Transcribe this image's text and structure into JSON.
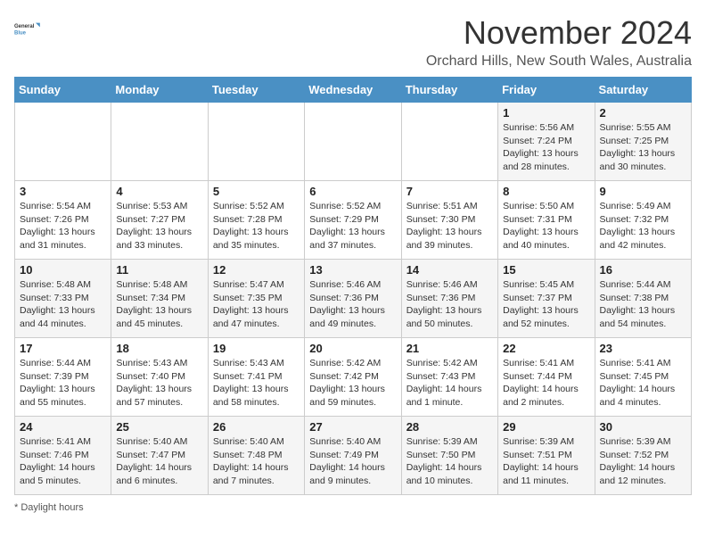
{
  "logo": {
    "line1": "General",
    "line2": "Blue"
  },
  "header": {
    "month": "November 2024",
    "location": "Orchard Hills, New South Wales, Australia"
  },
  "weekdays": [
    "Sunday",
    "Monday",
    "Tuesday",
    "Wednesday",
    "Thursday",
    "Friday",
    "Saturday"
  ],
  "weeks": [
    [
      {
        "day": "",
        "info": ""
      },
      {
        "day": "",
        "info": ""
      },
      {
        "day": "",
        "info": ""
      },
      {
        "day": "",
        "info": ""
      },
      {
        "day": "",
        "info": ""
      },
      {
        "day": "1",
        "info": "Sunrise: 5:56 AM\nSunset: 7:24 PM\nDaylight: 13 hours and 28 minutes."
      },
      {
        "day": "2",
        "info": "Sunrise: 5:55 AM\nSunset: 7:25 PM\nDaylight: 13 hours and 30 minutes."
      }
    ],
    [
      {
        "day": "3",
        "info": "Sunrise: 5:54 AM\nSunset: 7:26 PM\nDaylight: 13 hours and 31 minutes."
      },
      {
        "day": "4",
        "info": "Sunrise: 5:53 AM\nSunset: 7:27 PM\nDaylight: 13 hours and 33 minutes."
      },
      {
        "day": "5",
        "info": "Sunrise: 5:52 AM\nSunset: 7:28 PM\nDaylight: 13 hours and 35 minutes."
      },
      {
        "day": "6",
        "info": "Sunrise: 5:52 AM\nSunset: 7:29 PM\nDaylight: 13 hours and 37 minutes."
      },
      {
        "day": "7",
        "info": "Sunrise: 5:51 AM\nSunset: 7:30 PM\nDaylight: 13 hours and 39 minutes."
      },
      {
        "day": "8",
        "info": "Sunrise: 5:50 AM\nSunset: 7:31 PM\nDaylight: 13 hours and 40 minutes."
      },
      {
        "day": "9",
        "info": "Sunrise: 5:49 AM\nSunset: 7:32 PM\nDaylight: 13 hours and 42 minutes."
      }
    ],
    [
      {
        "day": "10",
        "info": "Sunrise: 5:48 AM\nSunset: 7:33 PM\nDaylight: 13 hours and 44 minutes."
      },
      {
        "day": "11",
        "info": "Sunrise: 5:48 AM\nSunset: 7:34 PM\nDaylight: 13 hours and 45 minutes."
      },
      {
        "day": "12",
        "info": "Sunrise: 5:47 AM\nSunset: 7:35 PM\nDaylight: 13 hours and 47 minutes."
      },
      {
        "day": "13",
        "info": "Sunrise: 5:46 AM\nSunset: 7:36 PM\nDaylight: 13 hours and 49 minutes."
      },
      {
        "day": "14",
        "info": "Sunrise: 5:46 AM\nSunset: 7:36 PM\nDaylight: 13 hours and 50 minutes."
      },
      {
        "day": "15",
        "info": "Sunrise: 5:45 AM\nSunset: 7:37 PM\nDaylight: 13 hours and 52 minutes."
      },
      {
        "day": "16",
        "info": "Sunrise: 5:44 AM\nSunset: 7:38 PM\nDaylight: 13 hours and 54 minutes."
      }
    ],
    [
      {
        "day": "17",
        "info": "Sunrise: 5:44 AM\nSunset: 7:39 PM\nDaylight: 13 hours and 55 minutes."
      },
      {
        "day": "18",
        "info": "Sunrise: 5:43 AM\nSunset: 7:40 PM\nDaylight: 13 hours and 57 minutes."
      },
      {
        "day": "19",
        "info": "Sunrise: 5:43 AM\nSunset: 7:41 PM\nDaylight: 13 hours and 58 minutes."
      },
      {
        "day": "20",
        "info": "Sunrise: 5:42 AM\nSunset: 7:42 PM\nDaylight: 13 hours and 59 minutes."
      },
      {
        "day": "21",
        "info": "Sunrise: 5:42 AM\nSunset: 7:43 PM\nDaylight: 14 hours and 1 minute."
      },
      {
        "day": "22",
        "info": "Sunrise: 5:41 AM\nSunset: 7:44 PM\nDaylight: 14 hours and 2 minutes."
      },
      {
        "day": "23",
        "info": "Sunrise: 5:41 AM\nSunset: 7:45 PM\nDaylight: 14 hours and 4 minutes."
      }
    ],
    [
      {
        "day": "24",
        "info": "Sunrise: 5:41 AM\nSunset: 7:46 PM\nDaylight: 14 hours and 5 minutes."
      },
      {
        "day": "25",
        "info": "Sunrise: 5:40 AM\nSunset: 7:47 PM\nDaylight: 14 hours and 6 minutes."
      },
      {
        "day": "26",
        "info": "Sunrise: 5:40 AM\nSunset: 7:48 PM\nDaylight: 14 hours and 7 minutes."
      },
      {
        "day": "27",
        "info": "Sunrise: 5:40 AM\nSunset: 7:49 PM\nDaylight: 14 hours and 9 minutes."
      },
      {
        "day": "28",
        "info": "Sunrise: 5:39 AM\nSunset: 7:50 PM\nDaylight: 14 hours and 10 minutes."
      },
      {
        "day": "29",
        "info": "Sunrise: 5:39 AM\nSunset: 7:51 PM\nDaylight: 14 hours and 11 minutes."
      },
      {
        "day": "30",
        "info": "Sunrise: 5:39 AM\nSunset: 7:52 PM\nDaylight: 14 hours and 12 minutes."
      }
    ]
  ],
  "footer": {
    "note": "Daylight hours"
  }
}
